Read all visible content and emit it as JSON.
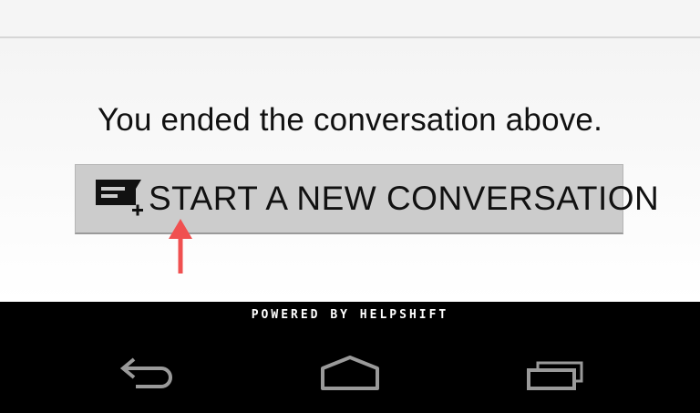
{
  "message": {
    "ended_text": "You ended the conversation above."
  },
  "new_conversation_button": {
    "label": "START A NEW CONVERSATION",
    "icon": "new-conversation-icon"
  },
  "footer": {
    "powered_by": "POWERED BY HELPSHIFT"
  },
  "navbar": {
    "back_icon": "back-icon",
    "home_icon": "home-icon",
    "recent_apps_icon": "recent-apps-icon"
  },
  "colors": {
    "button_bg": "#cccccc",
    "annotation_arrow": "#f05050",
    "navbar_bg": "#000000",
    "nav_icon": "#9a9a9a"
  }
}
